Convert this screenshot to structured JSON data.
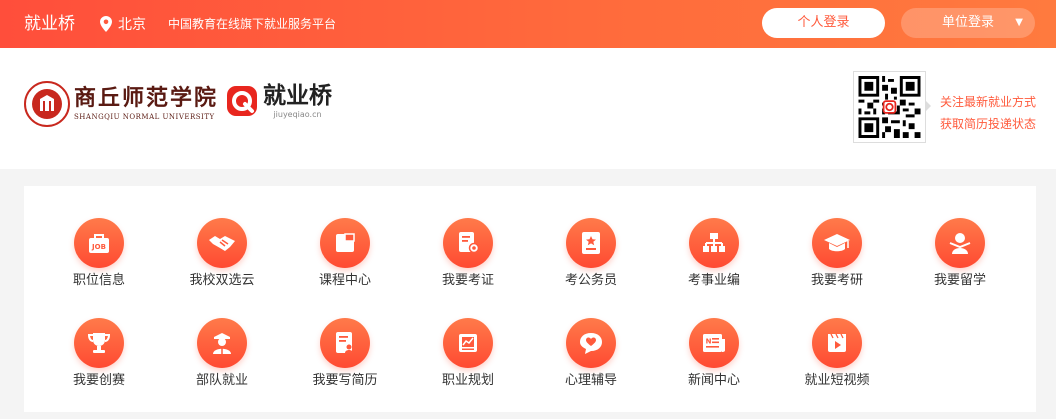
{
  "topbar": {
    "brand": "就业桥",
    "location": "北京",
    "slogan": "中国教育在线旗下就业服务平台",
    "personal_login": "个人登录",
    "unit_login": "单位登录",
    "caret": "▼"
  },
  "header": {
    "school_name_cn": "商丘师范学院",
    "school_name_en": "SHANGQIU NORMAL UNIVERSITY",
    "jyq_name": "就业桥",
    "jyq_url": "jiuyeqiao.cn",
    "qr_note_line1": "关注最新就业方式",
    "qr_note_line2": "获取简历投递状态"
  },
  "menu": [
    {
      "label": "职位信息",
      "icon": "job-icon"
    },
    {
      "label": "我校双选云",
      "icon": "handshake-icon"
    },
    {
      "label": "课程中心",
      "icon": "book-icon"
    },
    {
      "label": "我要考证",
      "icon": "certificate-icon"
    },
    {
      "label": "考公务员",
      "icon": "document-star-icon"
    },
    {
      "label": "考事业编",
      "icon": "org-chart-icon"
    },
    {
      "label": "我要考研",
      "icon": "graduation-cap-icon"
    },
    {
      "label": "我要留学",
      "icon": "study-abroad-icon"
    },
    {
      "label": "我要创赛",
      "icon": "trophy-icon"
    },
    {
      "label": "部队就业",
      "icon": "soldier-icon"
    },
    {
      "label": "我要写简历",
      "icon": "resume-icon"
    },
    {
      "label": "职业规划",
      "icon": "chart-board-icon"
    },
    {
      "label": "心理辅导",
      "icon": "heart-chat-icon"
    },
    {
      "label": "新闻中心",
      "icon": "news-icon"
    },
    {
      "label": "就业短视频",
      "icon": "video-icon"
    }
  ],
  "colors": {
    "accent": "#ff5a3c",
    "topbar_start": "#ff4e3b",
    "topbar_end": "#ff7a3e"
  }
}
